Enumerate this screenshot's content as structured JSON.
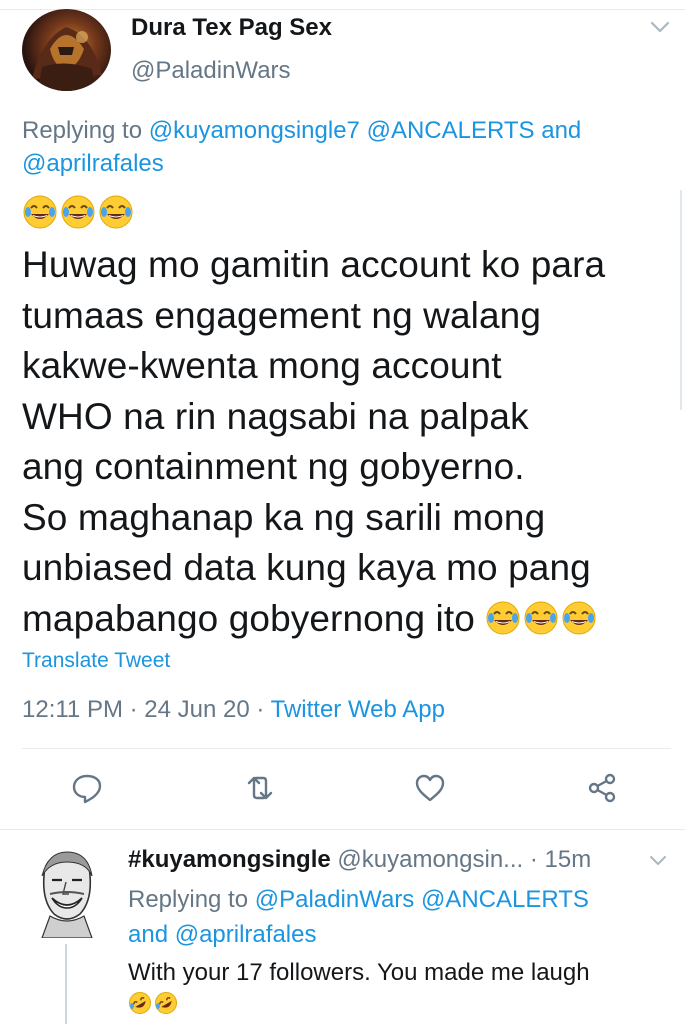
{
  "tweet": {
    "display_name": "Dura Tex Pag Sex",
    "handle": "@PaladinWars",
    "replying_prefix": "Replying to ",
    "replying_mention_1": "@kuyamongsingle7",
    "replying_mention_2": "@ANCALERTS",
    "replying_and": " and",
    "replying_mention_3": "@aprilrafales",
    "text_lines": [
      "Huwag mo gamitin account ko para",
      "tumaas engagement ng walang",
      "kakwe-kwenta mong account",
      "WHO na rin nagsabi na palpak",
      "ang containment ng gobyerno.",
      "So maghanap ka ng sarili mong",
      "unbiased data kung kaya mo pang",
      "mapabango gobyernong ito"
    ],
    "leading_emoji": "face-with-tears-of-joy x3",
    "trailing_emoji": "face-with-tears-of-joy x3",
    "translate": "Translate Tweet",
    "time": "12:11 PM",
    "sep1": " · ",
    "date": "24 Jun 20",
    "sep2": " · ",
    "source": "Twitter Web App",
    "icons": [
      "reply-icon",
      "retweet-icon",
      "like-icon",
      "share-icon",
      "chevron-down-icon"
    ]
  },
  "reply": {
    "name": "#kuyamongsingle",
    "handle": " @kuyamongsin...",
    "age": " · 15m",
    "replying_prefix": "Replying to ",
    "replying_mention_1": "@PaladinWars",
    "replying_mention_2": "@ANCALERTS",
    "replying_and": "and ",
    "replying_mention_3": "@aprilrafales",
    "text": "With your 17 followers. You made me laugh",
    "emoji": "rolling-on-the-floor-laughing x2"
  },
  "colors": {
    "text": "#14171a",
    "secondary": "#657786",
    "link": "#1b95e0",
    "divider": "#e6ecf0"
  }
}
